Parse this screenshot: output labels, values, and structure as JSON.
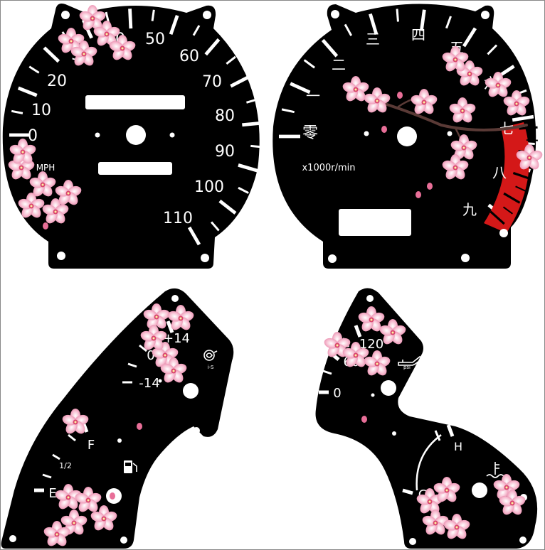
{
  "speedometer": {
    "labels": [
      "0",
      "10",
      "20",
      "30",
      "40",
      "50",
      "60",
      "70",
      "80",
      "90",
      "100",
      "110"
    ],
    "unit": "MPH"
  },
  "tachometer": {
    "labels": [
      "零",
      "一",
      "二",
      "三",
      "四",
      "五",
      "六",
      "七",
      "八",
      "九"
    ],
    "unit": "x1000r/min",
    "redline_color": "#e02020"
  },
  "boost_gauge": {
    "labels": [
      "-14",
      "0",
      "+14"
    ],
    "icon_label": "i-S"
  },
  "fuel_gauge": {
    "labels": [
      "E",
      "1/2",
      "F"
    ]
  },
  "oil_pressure_gauge": {
    "labels": [
      "0",
      "60",
      "120"
    ],
    "icon_label": "psi"
  },
  "temp_gauge": {
    "labels": [
      "C",
      "H"
    ]
  },
  "colors": {
    "face": "#000000",
    "markings": "#ffffff",
    "blossom": "#f2a9c4",
    "blossom_light": "#fbd6e3",
    "branch": "#5a3a36"
  }
}
